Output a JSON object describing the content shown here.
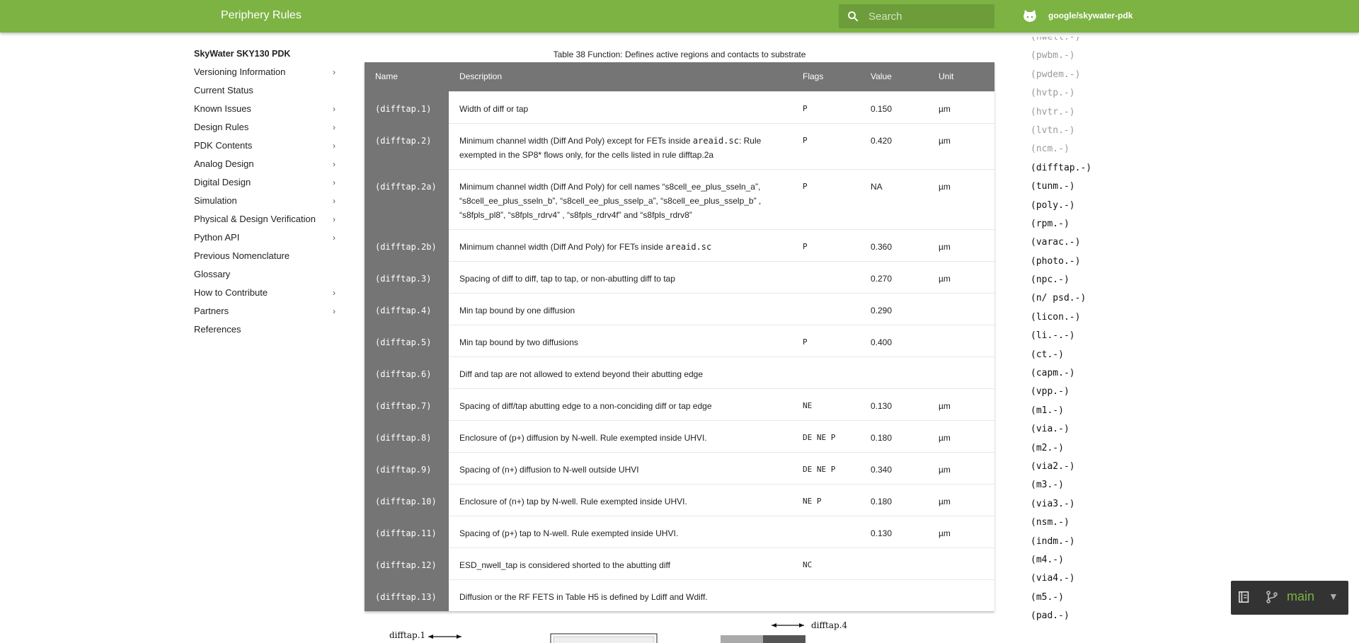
{
  "header": {
    "title": "Periphery Rules",
    "search_placeholder": "Search",
    "repo_name": "google/skywater-pdk",
    "bar_color": "#7cb342"
  },
  "nav": {
    "root": "SkyWater SKY130 PDK",
    "items": [
      {
        "label": "Versioning Information",
        "chevron": true
      },
      {
        "label": "Current Status",
        "chevron": false
      },
      {
        "label": "Known Issues",
        "chevron": true
      },
      {
        "label": "Design Rules",
        "chevron": true
      },
      {
        "label": "PDK Contents",
        "chevron": true
      },
      {
        "label": "Analog Design",
        "chevron": true
      },
      {
        "label": "Digital Design",
        "chevron": true
      },
      {
        "label": "Simulation",
        "chevron": true
      },
      {
        "label": "Physical & Design Verification",
        "chevron": true
      },
      {
        "label": "Python API",
        "chevron": true
      },
      {
        "label": "Previous Nomenclature",
        "chevron": false
      },
      {
        "label": "Glossary",
        "chevron": false
      },
      {
        "label": "How to Contribute",
        "chevron": true
      },
      {
        "label": "Partners",
        "chevron": true
      },
      {
        "label": "References",
        "chevron": false
      }
    ]
  },
  "table": {
    "caption": "Table 38 Function: Defines active regions and contacts to substrate",
    "headers": [
      "Name",
      "Description",
      "Flags",
      "Value",
      "Unit"
    ],
    "rows": [
      {
        "name": "(difftap.1)",
        "desc": [
          "Width of diff or tap"
        ],
        "flags": "P",
        "value": "0.150",
        "unit": "µm"
      },
      {
        "name": "(difftap.2)",
        "desc": [
          "Minimum channel width (Diff And Poly) except for FETs inside ",
          {
            "code": "areaid.sc"
          },
          ": Rule exempted in the SP8* flows only, for the cells listed in rule difftap.2a"
        ],
        "flags": "P",
        "value": "0.420",
        "unit": "µm"
      },
      {
        "name": "(difftap.2a)",
        "desc": [
          "Minimum channel width (Diff And Poly) for cell names “s8cell_ee_plus_sseln_a”, “s8cell_ee_plus_sseln_b”, “s8cell_ee_plus_sselp_a”, “s8cell_ee_plus_sselp_b” , “s8fpls_pl8”, “s8fpls_rdrv4” , “s8fpls_rdrv4f” and “s8fpls_rdrv8”"
        ],
        "flags": "P",
        "value": "NA",
        "unit": "µm"
      },
      {
        "name": "(difftap.2b)",
        "desc": [
          "Minimum channel width (Diff And Poly) for FETs inside ",
          {
            "code": "areaid.sc"
          }
        ],
        "flags": "P",
        "value": "0.360",
        "unit": "µm"
      },
      {
        "name": "(difftap.3)",
        "desc": [
          "Spacing of diff to diff, tap to tap, or non-abutting diff to tap"
        ],
        "flags": "",
        "value": "0.270",
        "unit": "µm"
      },
      {
        "name": "(difftap.4)",
        "desc": [
          "Min tap bound by one diffusion"
        ],
        "flags": "",
        "value": "0.290",
        "unit": ""
      },
      {
        "name": "(difftap.5)",
        "desc": [
          "Min tap bound by two diffusions"
        ],
        "flags": "P",
        "value": "0.400",
        "unit": ""
      },
      {
        "name": "(difftap.6)",
        "desc": [
          "Diff and tap are not allowed to extend beyond their abutting edge"
        ],
        "flags": "",
        "value": "",
        "unit": ""
      },
      {
        "name": "(difftap.7)",
        "desc": [
          "Spacing of diff/tap abutting edge to a non-conciding diff or tap edge"
        ],
        "flags": "NE",
        "value": "0.130",
        "unit": "µm"
      },
      {
        "name": "(difftap.8)",
        "desc": [
          "Enclosure of (p+) diffusion by N-well. Rule exempted inside UHVI."
        ],
        "flags": "DE NE P",
        "value": "0.180",
        "unit": "µm"
      },
      {
        "name": "(difftap.9)",
        "desc": [
          "Spacing of (n+) diffusion to N-well outside UHVI"
        ],
        "flags": "DE NE P",
        "value": "0.340",
        "unit": "µm"
      },
      {
        "name": "(difftap.10)",
        "desc": [
          "Enclosure of (n+) tap by N-well. Rule exempted inside UHVI."
        ],
        "flags": "NE P",
        "value": "0.180",
        "unit": "µm"
      },
      {
        "name": "(difftap.11)",
        "desc": [
          "Spacing of (p+) tap to N-well. Rule exempted inside UHVI."
        ],
        "flags": "",
        "value": "0.130",
        "unit": "µm"
      },
      {
        "name": "(difftap.12)",
        "desc": [
          "ESD_nwell_tap is considered shorted to the abutting diff"
        ],
        "flags": "NC",
        "value": "",
        "unit": ""
      },
      {
        "name": "(difftap.13)",
        "desc": [
          "Diffusion or the RF FETS in Table H5 is defined by Ldiff and Wdiff."
        ],
        "flags": "",
        "value": "",
        "unit": ""
      }
    ]
  },
  "toc": {
    "faded": [
      "(nwell.-)",
      "(pwbm.-)",
      "(pwdem.-)",
      "(hvtp.-)",
      "(hvtr.-)",
      "(lvtn.-)",
      "(ncm.-)"
    ],
    "items": [
      "(difftap.-)",
      "(tunm.-)",
      "(poly.-)",
      "(rpm.-)",
      "(varac.-)",
      "(photo.-)",
      "(npc.-)",
      "(n/ psd.-)",
      "(licon.-)",
      "(li.-.-)",
      "(ct.-)",
      "(capm.-)",
      "(vpp.-)",
      "(m1.-)",
      "(via.-)",
      "(m2.-)",
      "(via2.-)",
      "(m3.-)",
      "(via3.-)",
      "(nsm.-)",
      "(indm.-)",
      "(m4.-)",
      "(via4.-)",
      "(m5.-)",
      "(pad.-)"
    ]
  },
  "version": {
    "label": "main"
  },
  "figures": {
    "labels": [
      "difftap.1",
      "difftap.4"
    ]
  }
}
